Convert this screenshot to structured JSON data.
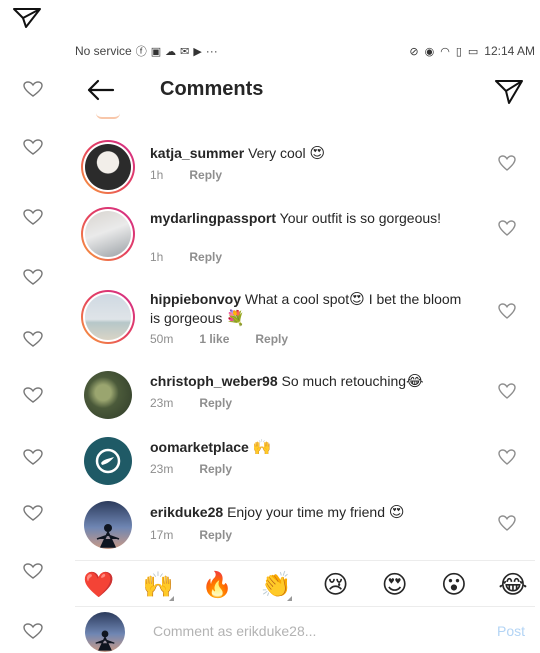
{
  "status_bar": {
    "carrier": "No service",
    "notification_icons": [
      "facebook-icon",
      "s-app-icon",
      "cloud-icon",
      "mail-icon",
      "play-icon"
    ],
    "more": "···",
    "time": "12:14 AM"
  },
  "header": {
    "title": "Comments",
    "back_icon": "arrow-left-icon",
    "share_icon": "paper-plane-icon"
  },
  "comments": [
    {
      "user": "katja_summer",
      "text": "Very cool",
      "emoji": "😍",
      "time": "1h",
      "likes": "",
      "reply": "Reply"
    },
    {
      "user": "mydarlingpassport",
      "text": "Your outfit is so gorgeous!",
      "emoji": "",
      "time": "1h",
      "likes": "",
      "reply": "Reply"
    },
    {
      "user": "hippiebonvoy",
      "text": "What a cool spot",
      "emoji": "😍",
      "text2": "I bet the bloom is gorgeous",
      "emoji2": "💐",
      "time": "50m",
      "likes": "1 like",
      "reply": "Reply"
    },
    {
      "user": "christoph_weber98",
      "text": "So much retouching",
      "emoji": "😂",
      "time": "23m",
      "likes": "",
      "reply": "Reply"
    },
    {
      "user": "oomarketplace",
      "text": "",
      "emoji": "🙌",
      "time": "23m",
      "likes": "",
      "reply": "Reply"
    },
    {
      "user": "erikduke28",
      "text": "Enjoy your time my friend",
      "emoji": "😍",
      "time": "17m",
      "likes": "",
      "reply": "Reply"
    }
  ],
  "emoji_bar": [
    "❤️",
    "🙌",
    "🔥",
    "👏",
    "😢",
    "😍",
    "😮",
    "😂"
  ],
  "composer": {
    "placeholder": "Comment as erikduke28...",
    "post_label": "Post"
  },
  "colors": {
    "post_disabled": "#b3d4f5",
    "story_ring_start": "#f9a13a",
    "story_ring_end": "#d22d8b",
    "meta_gray": "#8e8e8e"
  }
}
